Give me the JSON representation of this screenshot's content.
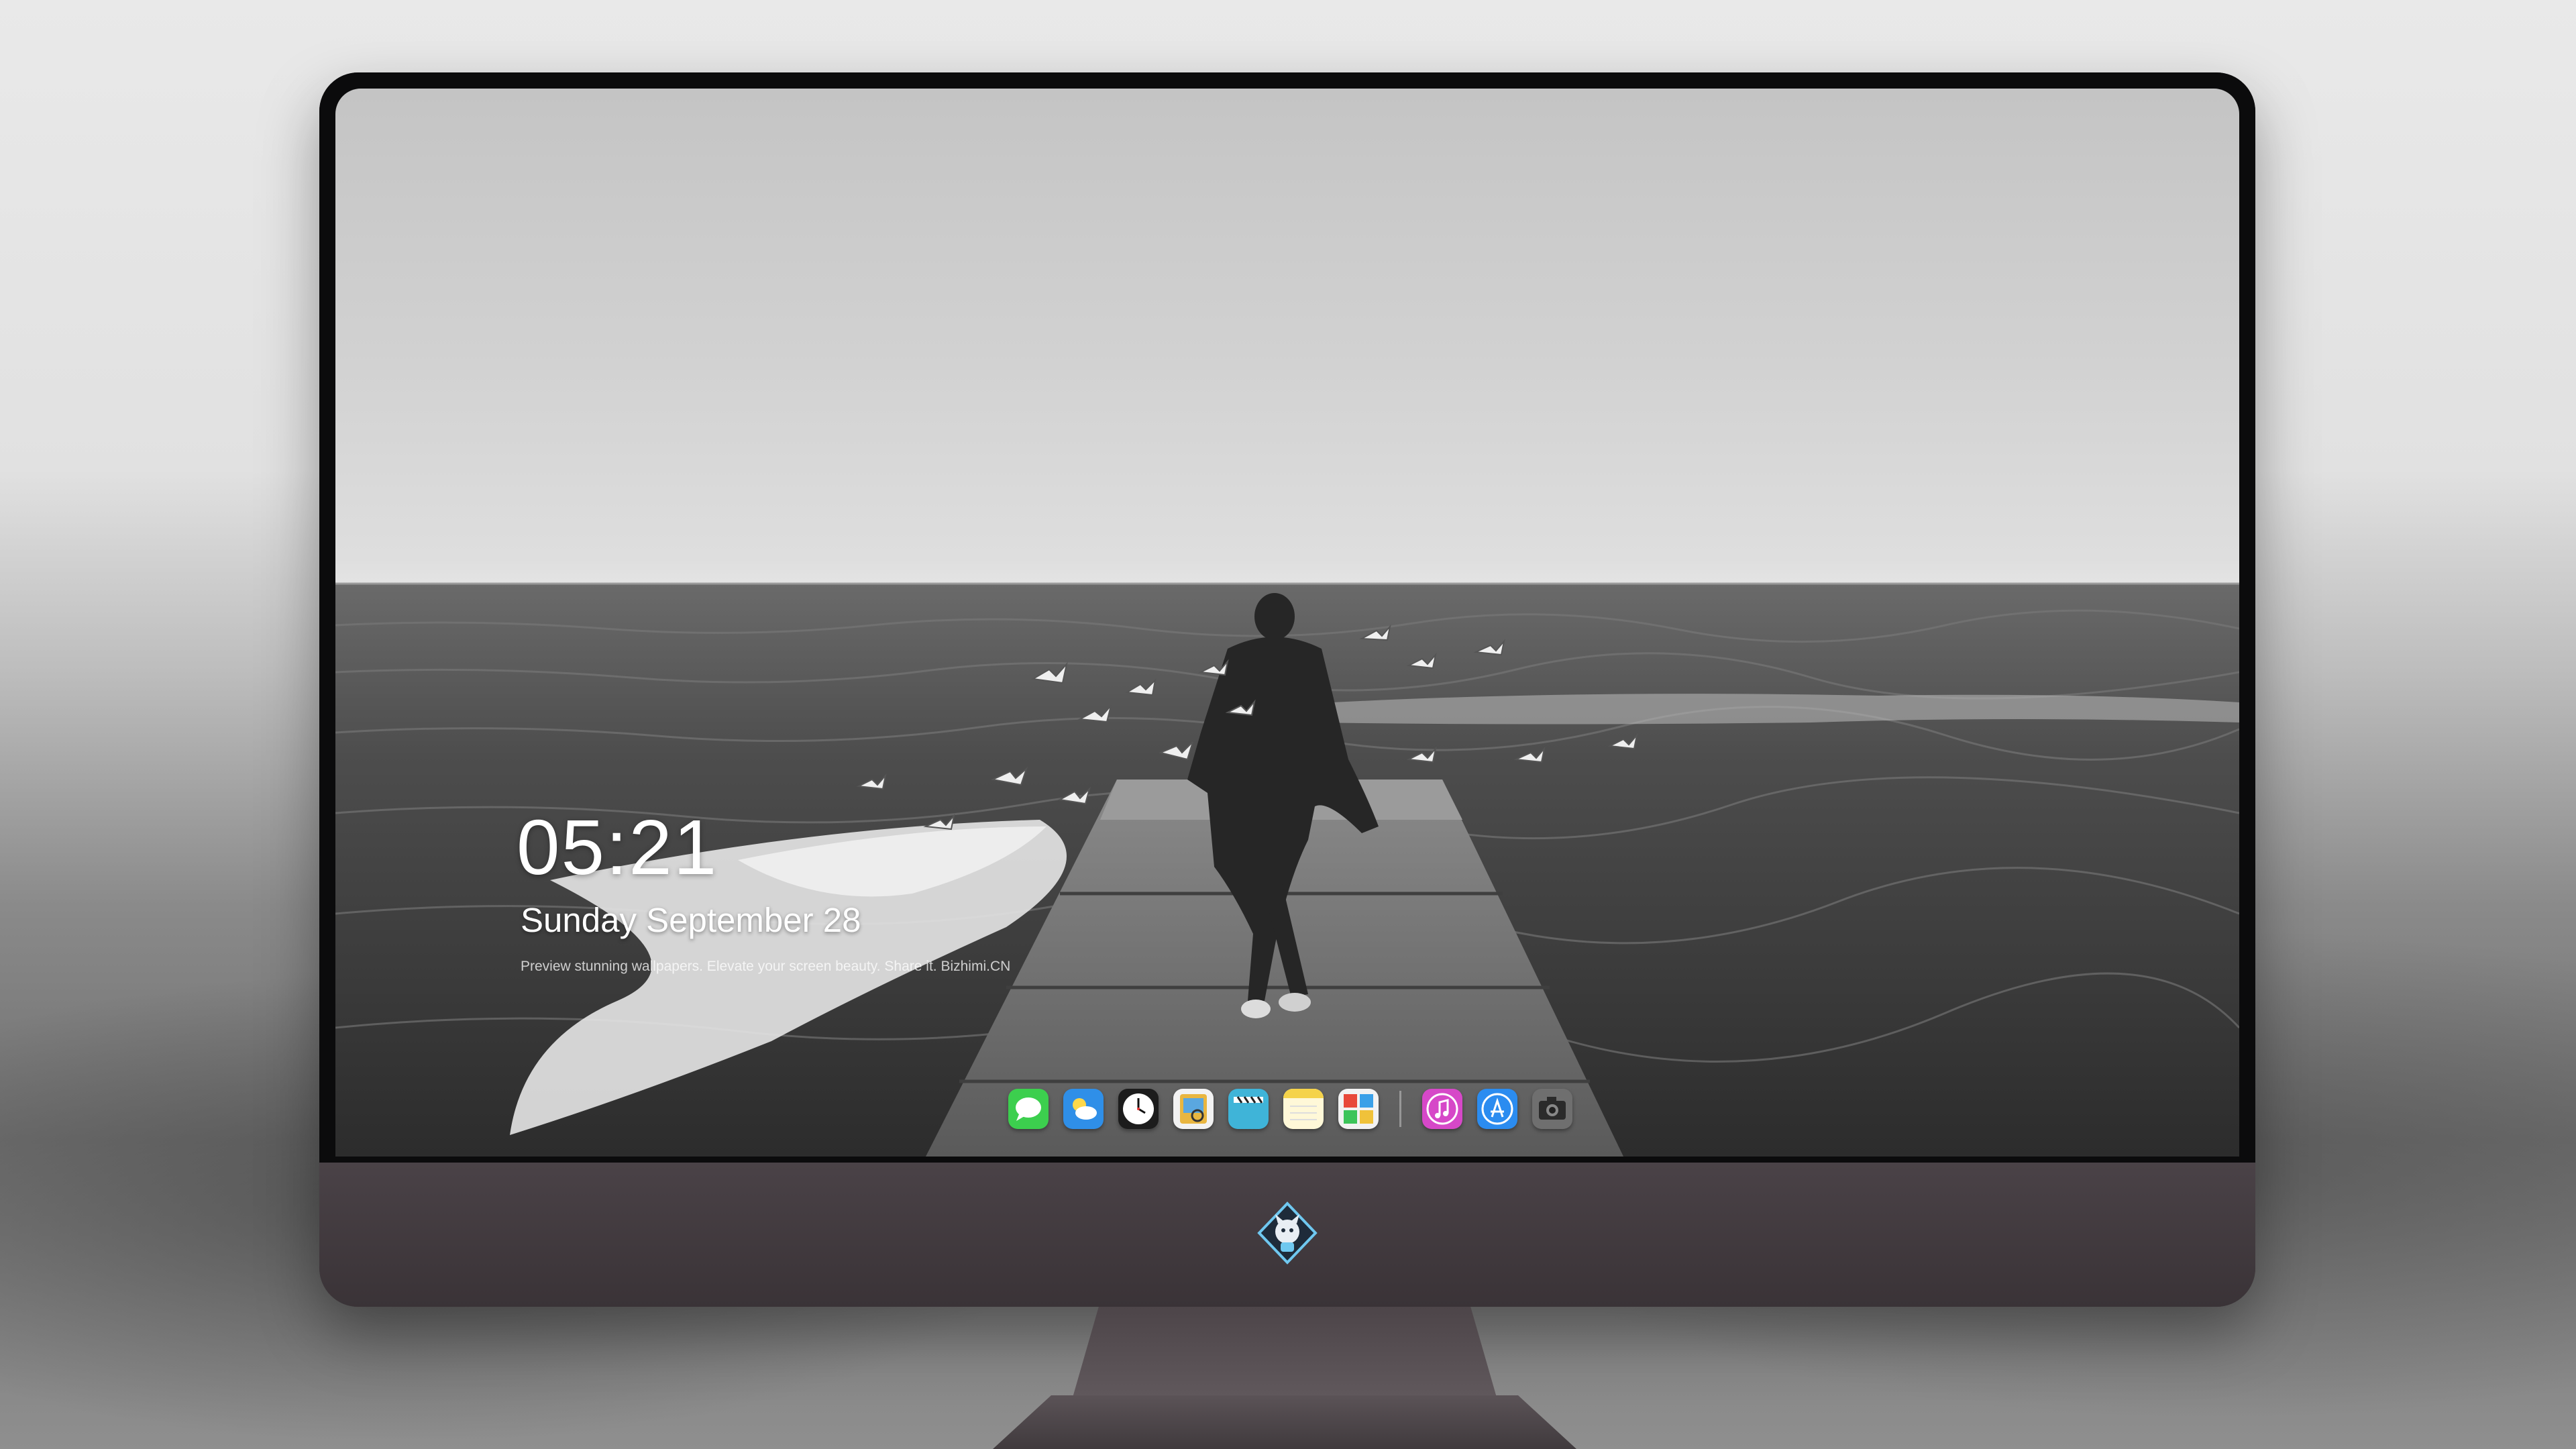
{
  "lockscreen": {
    "time": "05:21",
    "date_text": "Sunday September  28",
    "tagline": "Preview stunning wallpapers. Elevate your screen beauty. Share it. Bizhimi.CN"
  },
  "dock": {
    "apps": [
      {
        "name": "messages-icon",
        "color": "#3ccf4e"
      },
      {
        "name": "weather-icon",
        "color": "#2f8fe8"
      },
      {
        "name": "clock-icon",
        "color": "#1c1c1c"
      },
      {
        "name": "preview-icon",
        "color": "#e9b640"
      },
      {
        "name": "clips-icon",
        "color": "#3fb4d8"
      },
      {
        "name": "notes-icon",
        "color": "#f5d34a"
      },
      {
        "name": "photo-booth-icon",
        "color": "#e8483a"
      },
      {
        "name": "music-icon",
        "color": "#d648c8"
      },
      {
        "name": "app-store-icon",
        "color": "#2b8cf0"
      },
      {
        "name": "camera-icon",
        "color": "#6f6f6f"
      }
    ]
  },
  "colors": {
    "monitor_body": "#3c3539",
    "bezel": "#0b0b0c",
    "sky": "#d8d8d8",
    "sea": "#4a4a4a"
  }
}
